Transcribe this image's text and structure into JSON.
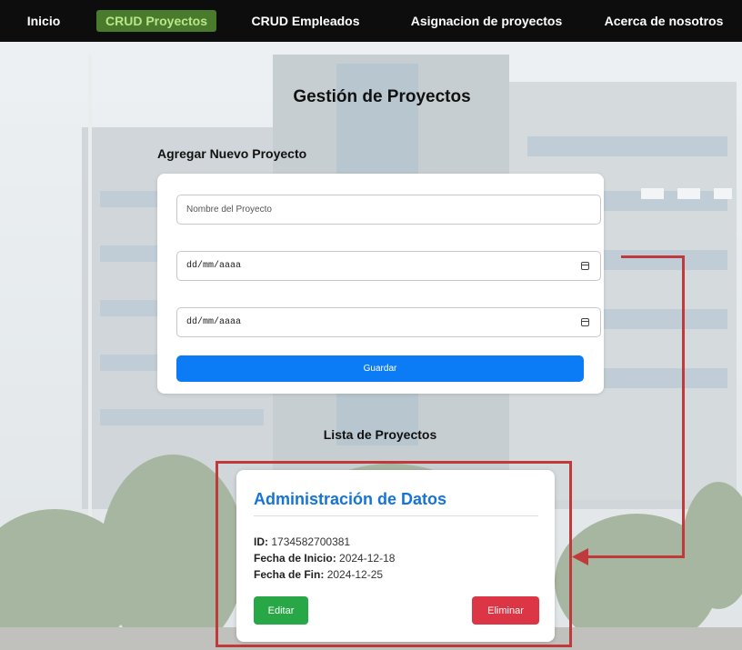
{
  "nav": {
    "items": [
      {
        "label": "Inicio"
      },
      {
        "label": "CRUD Proyectos"
      },
      {
        "label": "CRUD Empleados"
      },
      {
        "label": "Asignacion de proyectos"
      },
      {
        "label": "Acerca de nosotros"
      }
    ],
    "active_index": 1
  },
  "page": {
    "title": "Gestión de Proyectos",
    "form_section_title": "Agregar Nuevo Proyecto",
    "list_section_title": "Lista de Proyectos"
  },
  "form": {
    "name_placeholder": "Nombre del Proyecto",
    "start_date_placeholder": "dd/mm/aaaa",
    "end_date_placeholder": "dd/mm/aaaa",
    "save_label": "Guardar"
  },
  "projects": [
    {
      "name": "Administración de Datos",
      "id_label": "ID:",
      "id": "1734582700381",
      "start_label": "Fecha de Inicio:",
      "start": "2024-12-18",
      "end_label": "Fecha de Fin:",
      "end": "2024-12-25",
      "edit_label": "Editar",
      "delete_label": "Eliminar"
    }
  ],
  "colors": {
    "nav_bg": "#0d0d0d",
    "nav_active_bg": "#4a7a2c",
    "nav_active_text": "#b8e68a",
    "primary": "#0b7cf5",
    "success": "#27a745",
    "danger": "#dc3545",
    "project_title": "#1574d4",
    "annotation": "#c0393b"
  }
}
